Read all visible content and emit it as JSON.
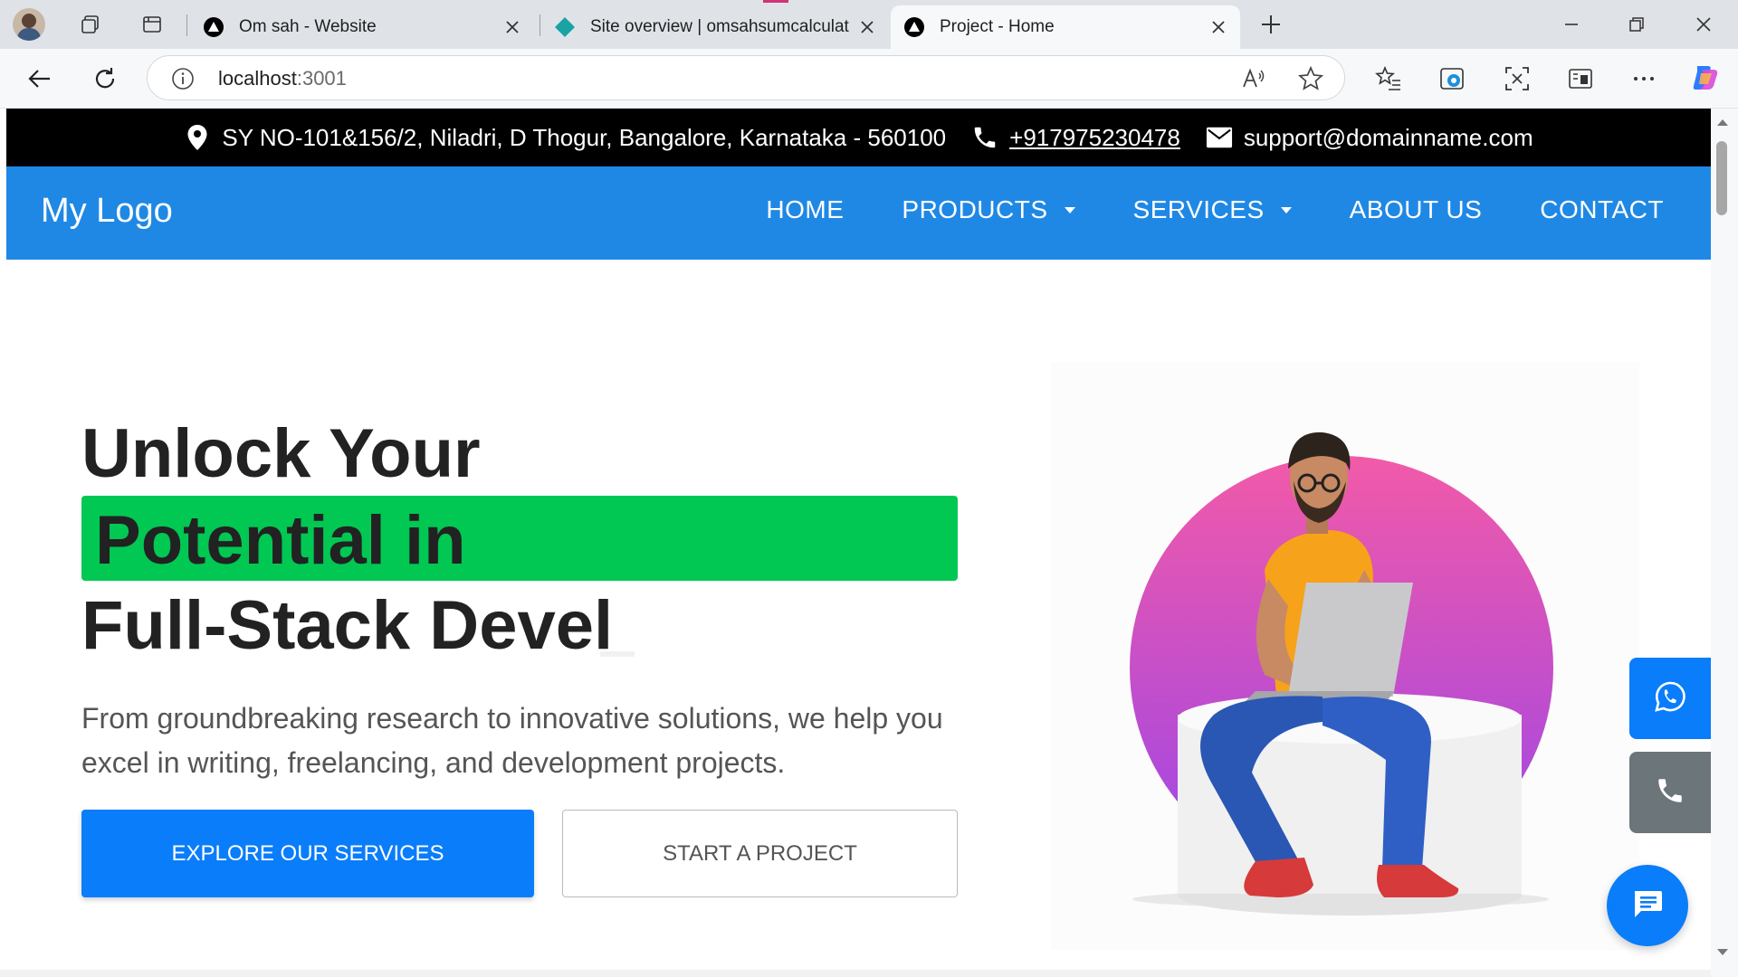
{
  "browser": {
    "tabs": [
      {
        "title": "Om sah - Website",
        "favicon": "triangle-logo-icon"
      },
      {
        "title": "Site overview | omsahsumcalculat",
        "favicon": "diamond-logo-icon"
      },
      {
        "title": "Project - Home",
        "favicon": "triangle-logo-icon",
        "active": true
      }
    ],
    "address": {
      "host": "localhost",
      "port": ":3001"
    }
  },
  "topbar": {
    "address": "SY NO-101&156/2, Niladri, D Thogur, Bangalore, Karnataka - 560100",
    "phone": "+917975230478",
    "email": "support@domainname.com"
  },
  "nav": {
    "logo": "My Logo",
    "items": [
      {
        "label": "HOME"
      },
      {
        "label": "PRODUCTS",
        "dropdown": true
      },
      {
        "label": "SERVICES",
        "dropdown": true
      },
      {
        "label": "ABOUT US"
      },
      {
        "label": "CONTACT"
      }
    ]
  },
  "hero": {
    "line1": "Unlock Your",
    "line2": "Potential in",
    "line3": "Full-Stack Devel",
    "subtitle": "From groundbreaking research to innovative solutions, we help you excel in writing, freelancing, and development projects.",
    "primary_button": "EXPLORE OUR SERVICES",
    "secondary_button": "START A PROJECT"
  },
  "colors": {
    "nav_bg": "#1f88e5",
    "highlight": "#00c853",
    "primary": "#0a7dfa",
    "topbar_bg": "#000000",
    "phone_float": "#6c7579"
  }
}
